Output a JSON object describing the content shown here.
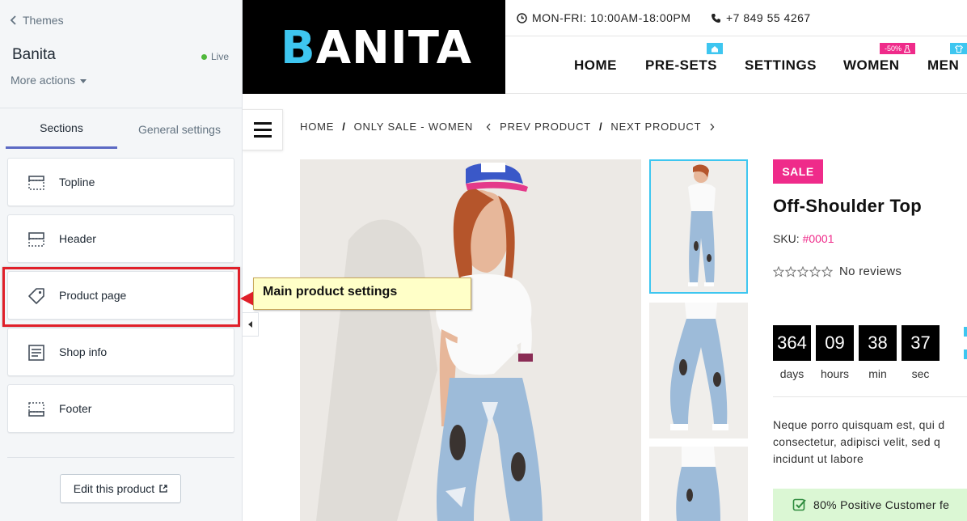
{
  "editor": {
    "back_label": "Themes",
    "theme_name": "Banita",
    "live_label": "Live",
    "more_actions_label": "More actions",
    "tabs": [
      {
        "label": "Sections"
      },
      {
        "label": "General settings"
      }
    ],
    "section_cards": [
      {
        "label": "Topline",
        "icon": "topline-section-icon"
      },
      {
        "label": "Header",
        "icon": "header-section-icon"
      },
      {
        "label": "Product page",
        "icon": "tag-icon"
      },
      {
        "label": "Shop info",
        "icon": "text-section-icon"
      },
      {
        "label": "Footer",
        "icon": "footer-section-icon"
      }
    ],
    "edit_product_label": "Edit this product"
  },
  "callout": {
    "text": "Main product settings",
    "color": "#e0202a"
  },
  "store": {
    "logo_first": "B",
    "logo_rest": "ANITA",
    "hours": "MON-FRI: 10:00AM-18:00PM",
    "phone": "+7 849 55 4267",
    "nav": [
      {
        "label": "HOME"
      },
      {
        "label": "PRE-SETS",
        "badge_icon": "home-icon"
      },
      {
        "label": "SETTINGS"
      },
      {
        "label": "WOMEN",
        "badge": "-50%"
      },
      {
        "label": "MEN",
        "badge_icon": "shirt-icon"
      }
    ],
    "breadcrumb": {
      "home": "HOME",
      "sep": "/",
      "collection": "ONLY SALE - WOMEN",
      "prev": "PREV PRODUCT",
      "next": "NEXT PRODUCT"
    },
    "product": {
      "sale_label": "SALE",
      "title": "Off-Shoulder Top",
      "sku_label": "SKU:",
      "sku_value": "#0001",
      "rating": 0,
      "reviews_label": "No reviews",
      "countdown": [
        {
          "value": "364",
          "label": "days"
        },
        {
          "value": "09",
          "label": "hours"
        },
        {
          "value": "38",
          "label": "min"
        },
        {
          "value": "37",
          "label": "sec"
        }
      ],
      "description_lines": [
        "Neque porro quisquam est, qui d",
        "consectetur, adipisci velit, sed q",
        "incidunt ut labore"
      ],
      "positive_feedback": "80% Positive Customer fe"
    },
    "colors": {
      "accent_blue": "#3ec6f0",
      "accent_pink": "#ef2b8a",
      "editor_tab_active": "#5c6ac4",
      "live_green": "#50b83c"
    }
  }
}
